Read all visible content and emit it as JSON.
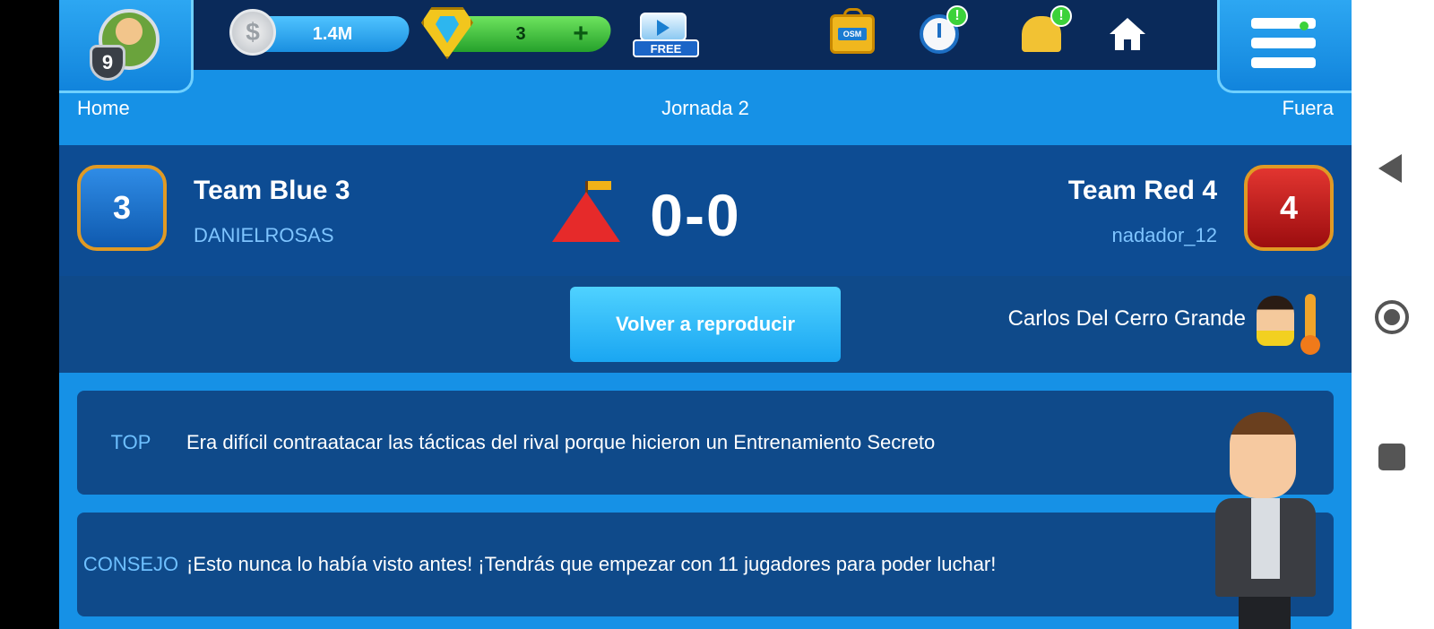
{
  "topbar": {
    "level": "9",
    "coins": "1.4M",
    "coin_symbol": "$",
    "boss_coins": "3",
    "free_video_label": "FREE",
    "osm_label": "OSM",
    "timer_alert": "!",
    "bell_alert": "!"
  },
  "round": {
    "home_label": "Home",
    "title": "Jornada 2",
    "away_label": "Fuera"
  },
  "match": {
    "home": {
      "shirt_number": "3",
      "team": "Team Blue 3",
      "manager": "DANIELROSAS"
    },
    "away": {
      "shirt_number": "4",
      "team": "Team Red 4",
      "manager": "nadador_12"
    },
    "score": "0-0"
  },
  "replay": {
    "button_label": "Volver a reproducir",
    "referee": "Carlos Del Cerro Grande"
  },
  "messages": [
    {
      "tag": "TOP",
      "text": "Era difícil contraatacar las tácticas del rival porque hicieron un Entrenamiento Secreto"
    },
    {
      "tag": "CONSEJO",
      "text": "¡Esto nunca lo había visto antes! ¡Tendrás que empezar con 11 jugadores para poder luchar!"
    }
  ],
  "colors": {
    "accent": "#1691e6",
    "panel_dark": "#0d4c93",
    "button": "#1aa6f2",
    "tag_text": "#6ec0ff"
  }
}
